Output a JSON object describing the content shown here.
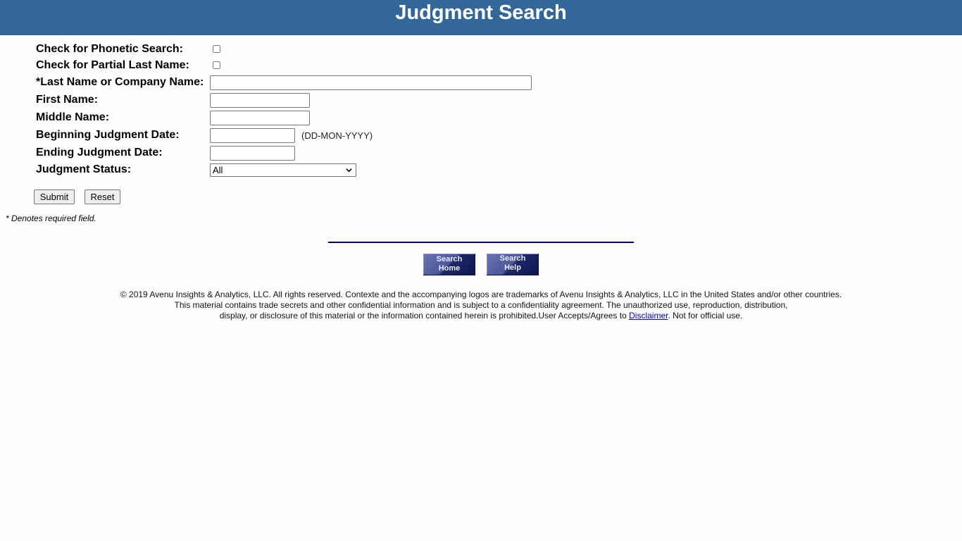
{
  "header": {
    "title": "Judgment Search"
  },
  "form": {
    "phonetic_label": "Check for Phonetic Search:",
    "phonetic_checked": false,
    "partial_label": "Check for Partial Last Name:",
    "partial_checked": false,
    "last_name_label": "*Last Name or Company Name:",
    "last_name_value": "",
    "first_name_label": "First Name:",
    "first_name_value": "",
    "middle_name_label": "Middle Name:",
    "middle_name_value": "",
    "begin_date_label": "Beginning Judgment Date:",
    "begin_date_value": "",
    "date_format_hint": "(DD-MON-YYYY)",
    "end_date_label": "Ending Judgment Date:",
    "end_date_value": "",
    "status_label": "Judgment Status:",
    "status_selected": "All",
    "submit_label": "Submit",
    "reset_label": "Reset",
    "required_note": "* Denotes required field."
  },
  "nav": {
    "search_home_line1": "Search",
    "search_home_line2": "Home",
    "search_help_line1": "Search",
    "search_help_line2": "Help"
  },
  "footer": {
    "line1": "© 2019 Avenu Insights & Analytics, LLC. All rights reserved. Contexte and the accompanying logos are trademarks of Avenu Insights & Analytics, LLC in the United States and/or other countries.",
    "line2": "This material contains trade secrets and other confidential information and is subject to a confidentiality agreement. The unauthorized use, reproduction, distribution,",
    "line3_pre": "display, or disclosure of this material or the information contained herein is prohibited.User Accepts/Agrees to ",
    "disclaimer_link": "Disclaimer",
    "line3_post": ". Not for official use."
  },
  "colors": {
    "header_bg": "#336699",
    "rule": "#000080",
    "link": "#0000cc"
  }
}
